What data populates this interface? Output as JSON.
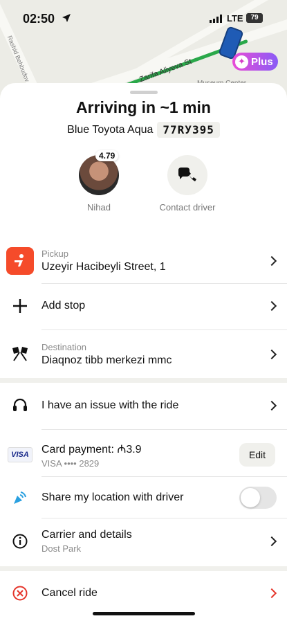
{
  "status_bar": {
    "time": "02:50",
    "network": "LTE",
    "battery": "79"
  },
  "map": {
    "street_labels": [
      "Zarifa Aliyeva St",
      "Museum Center",
      "Rashid Behbudov St"
    ],
    "plus_badge_label": "Plus"
  },
  "sheet": {
    "title": "Arriving in ~1 min",
    "car_description": "Blue Toyota Aqua",
    "plate_number": "77RУ395",
    "driver": {
      "name": "Nihad",
      "rating": "4.79"
    },
    "contact_label": "Contact driver"
  },
  "rows": {
    "pickup": {
      "label": "Pickup",
      "value": "Uzeyir Hacibeyli Street, 1"
    },
    "add_stop": {
      "label": "Add stop"
    },
    "destination": {
      "label": "Destination",
      "value": "Diaqnoz tibb merkezi mmc"
    },
    "issue": {
      "label": "I have an issue with the ride"
    },
    "payment": {
      "label": "Card payment: ₼3.9",
      "card": "VISA •••• 2829",
      "card_brand": "VISA",
      "edit_label": "Edit"
    },
    "share_location": {
      "label": "Share my location with driver",
      "enabled": false
    },
    "carrier": {
      "label": "Carrier and details",
      "value": "Dost Park"
    },
    "cancel": {
      "label": "Cancel ride"
    }
  },
  "colors": {
    "accent_red": "#e5352b",
    "pickup_orange": "#f54b2a",
    "route_green": "#2aa84a",
    "plus_gradient_start": "#e94cd6",
    "plus_gradient_end": "#8a5cf6"
  }
}
